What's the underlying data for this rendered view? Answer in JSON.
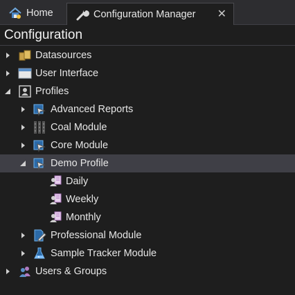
{
  "tabs": [
    {
      "label": "Home",
      "icon": "home-icon"
    },
    {
      "label": "Configuration Manager",
      "icon": "wrench-icon",
      "close": "✕"
    }
  ],
  "panel": {
    "title": "Configuration"
  },
  "tree": [
    {
      "label": "Datasources",
      "icon": "datasource-icon",
      "state": "collapsed"
    },
    {
      "label": "User Interface",
      "icon": "window-icon",
      "state": "collapsed"
    },
    {
      "label": "Profiles",
      "icon": "profile-icon",
      "state": "expanded"
    },
    {
      "label": "Advanced Reports",
      "icon": "module-icon",
      "state": "collapsed"
    },
    {
      "label": "Coal Module",
      "icon": "coal-icon",
      "state": "collapsed"
    },
    {
      "label": "Core Module",
      "icon": "module-icon",
      "state": "collapsed"
    },
    {
      "label": "Demo Profile",
      "icon": "module-icon",
      "state": "expanded",
      "selected": true
    },
    {
      "label": "Daily",
      "icon": "user-report-icon"
    },
    {
      "label": "Weekly",
      "icon": "user-report-icon"
    },
    {
      "label": "Monthly",
      "icon": "user-report-icon"
    },
    {
      "label": "Professional Module",
      "icon": "pen-doc-icon",
      "state": "collapsed"
    },
    {
      "label": "Sample Tracker Module",
      "icon": "flask-icon",
      "state": "collapsed"
    },
    {
      "label": "Users & Groups",
      "icon": "users-icon",
      "state": "collapsed"
    }
  ]
}
